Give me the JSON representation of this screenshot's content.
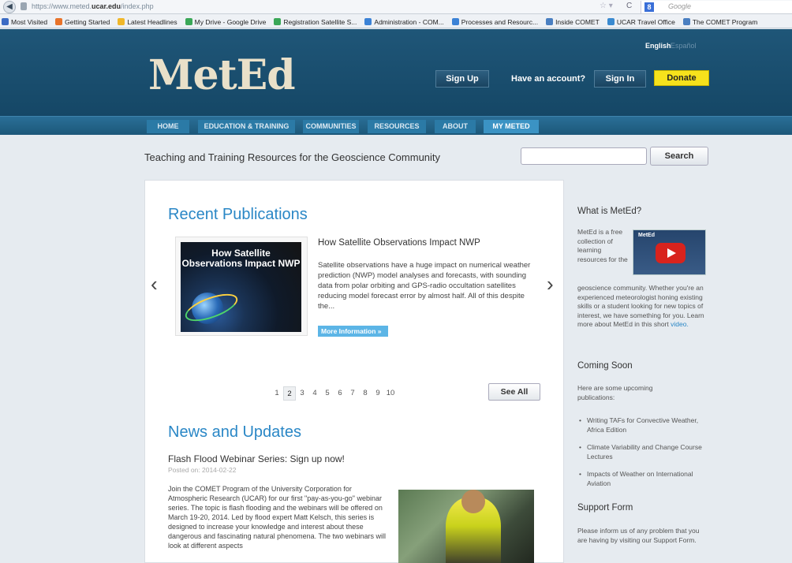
{
  "browser": {
    "url_prefix": "https://www.meted.",
    "url_domain": "ucar.edu",
    "url_suffix": "/index.php",
    "search_placeholder": "Google",
    "bookmarks": [
      "Most Visited",
      "Getting Started",
      "Latest Headlines",
      "My Drive - Google Drive",
      "Registration Satellite S...",
      "Administration - COM...",
      "Processes and Resourc...",
      "Inside COMET",
      "UCAR Travel Office",
      "The COMET Program"
    ],
    "bookmark_colors": [
      "#3b6bc4",
      "#e8732a",
      "#f0b72a",
      "#3aa757",
      "#3aa757",
      "#3b82d6",
      "#3b82d6",
      "#4a7fc1",
      "#3a8ad0",
      "#4a7fc1"
    ]
  },
  "header": {
    "lang_english": "English",
    "lang_spanish": "Español",
    "logo": "MetEd",
    "sign_up": "Sign Up",
    "have_account": "Have an account?",
    "sign_in": "Sign In",
    "donate": "Donate"
  },
  "nav": [
    "HOME",
    "EDUCATION & TRAINING",
    "COMMUNITIES",
    "RESOURCES",
    "ABOUT",
    "MY METED"
  ],
  "tagline": "Teaching and Training Resources for the Geoscience Community",
  "search": {
    "button": "Search",
    "value": ""
  },
  "recent": {
    "heading": "Recent Publications",
    "thumb_text": "How Satellite Observations Impact NWP",
    "title": "How Satellite Observations Impact NWP",
    "description": "Satellite observations have a huge impact on numerical weather prediction (NWP) model analyses and forecasts, with sounding data from polar orbiting and GPS-radio occultation satellites reducing model forecast error by almost half. All of this despite the...",
    "more": "More Information »",
    "pages": [
      "1",
      "2",
      "3",
      "4",
      "5",
      "6",
      "7",
      "8",
      "9",
      "10"
    ],
    "active_page": "2",
    "see_all": "See All"
  },
  "news": {
    "heading": "News and Updates",
    "title": "Flash Flood Webinar Series: Sign up now!",
    "date": "Posted on: 2014-02-22",
    "body": "Join the COMET Program of the University Corporation for Atmospheric Research (UCAR) for our first \"pay-as-you-go\" webinar series. The topic is flash flooding and the webinars will be offered on March 19-20, 2014. Led by flood expert Matt Kelsch, this series is designed to increase your knowledge and interest about these dangerous and fascinating natural phenomena. The two webinars will look at different aspects"
  },
  "sidebar": {
    "what_heading": "What is MetEd?",
    "what_text_1": "MetEd is a free collection of learning resources for the",
    "what_text_2": "geoscience community. Whether you're an experienced meteorologist honing existing skills or a student looking for new topics of interest, we have something for you. Learn more about MetEd in this short",
    "video_link": "video.",
    "video_caption": "MetEd",
    "coming_heading": "Coming Soon",
    "coming_text": "Here are some upcoming publications:",
    "coming_items": [
      "Writing TAFs for Convective Weather, Africa Edition",
      "Climate Variability and Change Course Lectures",
      "Impacts of Weather on International Aviation"
    ],
    "support_heading": "Support Form",
    "support_text": "Please inform us of any problem that you are having by visiting our Support Form."
  },
  "colors": {
    "accent": "#2a87c6",
    "donate": "#f7e21c",
    "header_bg": "#1f5678"
  }
}
